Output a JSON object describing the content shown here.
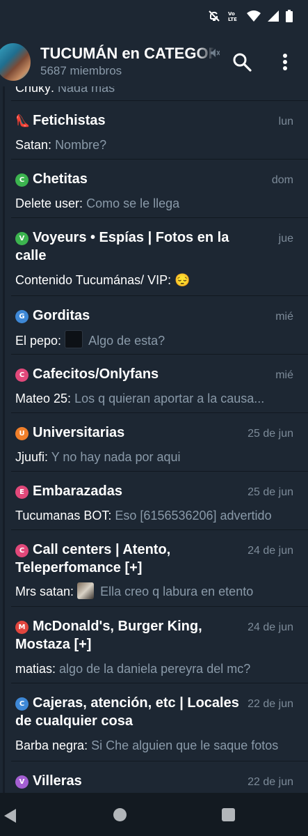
{
  "header": {
    "title": "TUCUMÁN en CATEGORÍAS",
    "subtitle": "5687 miembros"
  },
  "partial_top": {
    "sender": "Chuky:",
    "message": "Nada mas"
  },
  "chats": [
    {
      "badge_letter": "",
      "badge_color": "",
      "emoji": "👠",
      "title": "Fetichistas",
      "date": "lun",
      "sender": "Satan:",
      "message": "Nombre?"
    },
    {
      "badge_letter": "C",
      "badge_color": "#3cb44f",
      "title": "Chetitas",
      "date": "dom",
      "sender": "Delete user:",
      "message": "Como se le llega"
    },
    {
      "badge_letter": "V",
      "badge_color": "#3cb44f",
      "title": "Voyeurs • Espías | Fotos en la calle",
      "date": "jue",
      "sender": "Contenido Tucumánas/ VIP:",
      "message": "😔"
    },
    {
      "badge_letter": "G",
      "badge_color": "#3e88d6",
      "title": "Gorditas",
      "date": "mié",
      "sender": "El pepo:",
      "message": "Algo de esta?"
    },
    {
      "badge_letter": "C",
      "badge_color": "#e1487a",
      "title": "Cafecitos/Onlyfans",
      "date": "mié",
      "sender": "Mateo 25:",
      "message": "Los q quieran aportar a la causa..."
    },
    {
      "badge_letter": "U",
      "badge_color": "#f07f2a",
      "title": "Universitarias",
      "date": "25 de jun",
      "sender": "Jjuufi:",
      "message": "Y no hay nada por aqui"
    },
    {
      "badge_letter": "E",
      "badge_color": "#e1487a",
      "title": "Embarazadas",
      "date": "25 de jun",
      "sender": "Tucumanas BOT:",
      "message": "Eso [6156536206] advertido"
    },
    {
      "badge_letter": "C",
      "badge_color": "#e1487a",
      "title": "Call centers | Atento, Teleperfomance [+]",
      "date": "24 de jun",
      "sender": "Mrs satan:",
      "message": "Ella creo q labura en etento"
    },
    {
      "badge_letter": "M",
      "badge_color": "#e0453e",
      "title": "McDonald's, Burger King, Mostaza [+]",
      "date": "24 de jun",
      "sender": "matias:",
      "message": "algo de la daniela pereyra del mc?"
    },
    {
      "badge_letter": "C",
      "badge_color": "#3e88d6",
      "title": "Cajeras, atención, etc | Locales de cualquier cosa",
      "date": "22 de jun",
      "sender": "Barba negra:",
      "message": "Si Che alguien que le saque fotos"
    },
    {
      "badge_letter": "V",
      "badge_color": "#a45fd2",
      "title": "Villeras",
      "date": "22 de jun",
      "sender": "",
      "message": ""
    }
  ],
  "icons": {
    "search": "search-icon",
    "more": "more-vertical-icon",
    "mute": "mute-icon",
    "back": "back-icon",
    "home": "home-icon",
    "recents": "recents-icon"
  },
  "colors": {
    "background": "#1d2733",
    "secondary_text": "#8a9aa9",
    "date_text": "#7d8b99",
    "navbar": "#131a21"
  }
}
